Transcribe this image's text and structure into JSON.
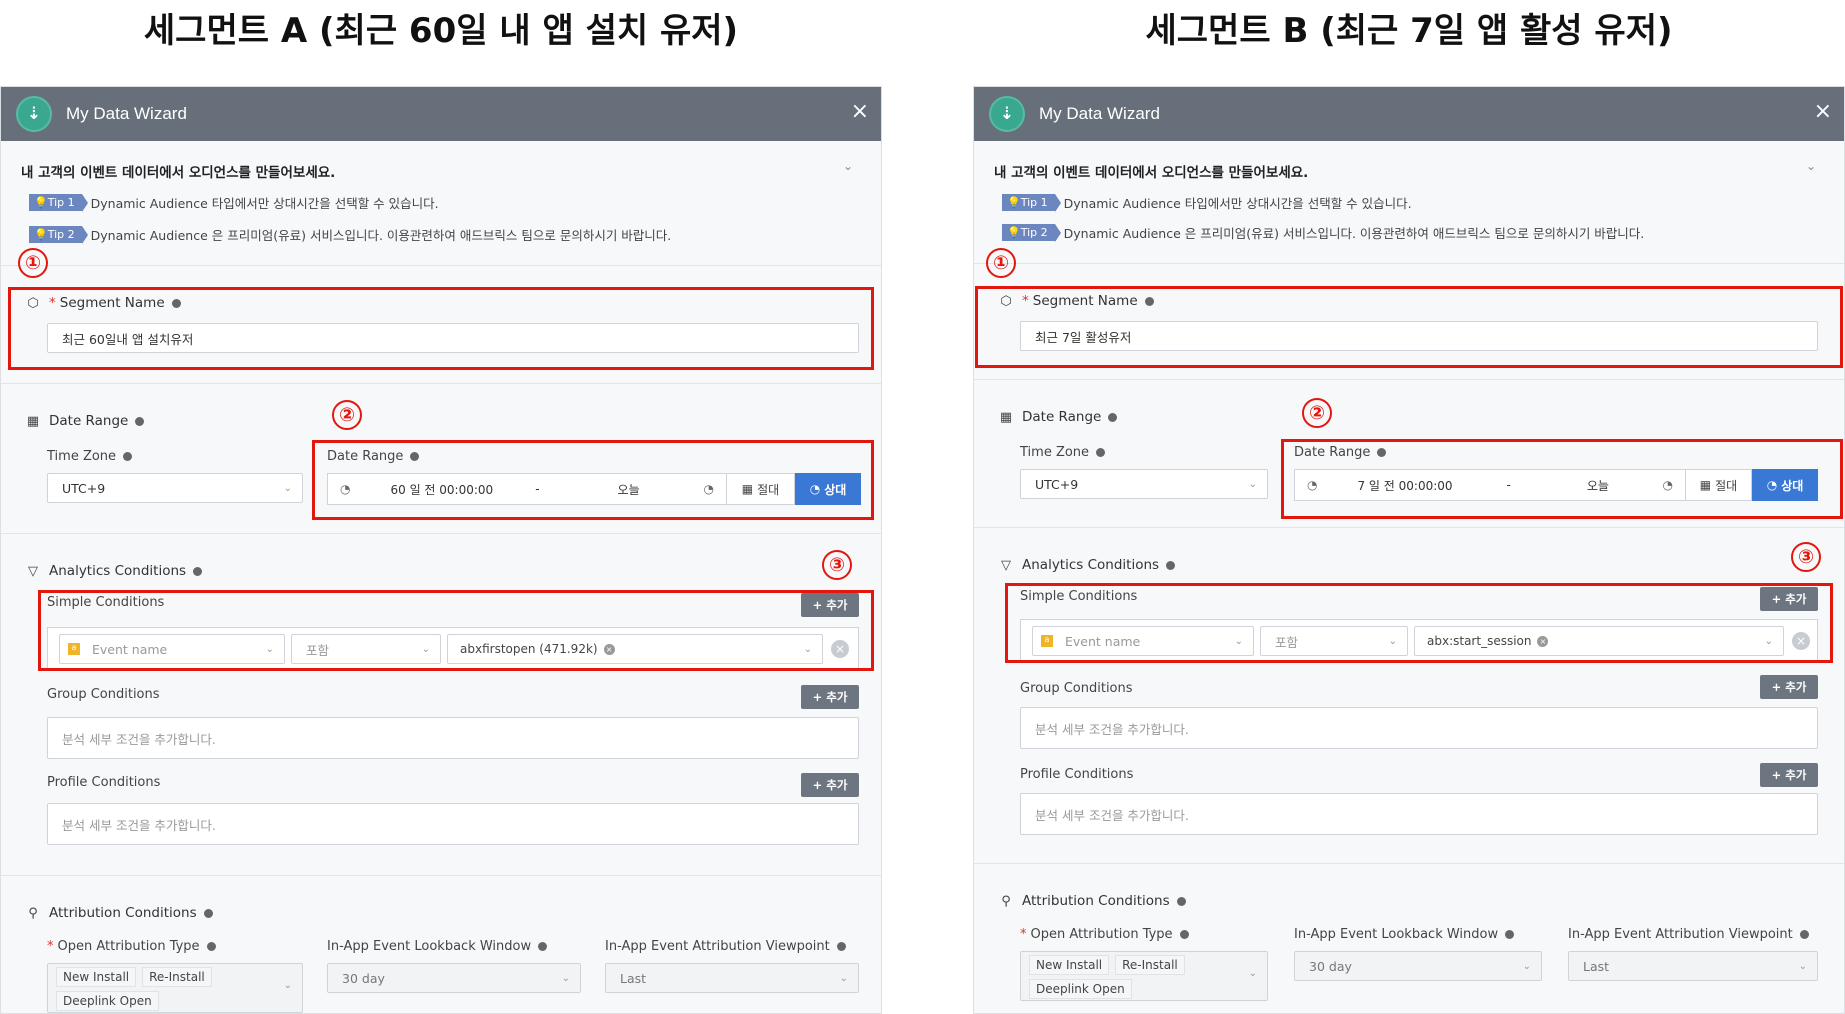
{
  "panels": [
    {
      "heading": "세그먼트 A (최근 60일 내 앱 설치 유저)",
      "app_title": "My Data Wizard",
      "close": "×",
      "description": "내 고객의 이벤트 데이터에서 오디언스를 만들어보세요.",
      "tips": [
        {
          "badge": "Tip 1",
          "text": "Dynamic Audience 타입에서만 상대시간을 선택할 수 있습니다."
        },
        {
          "badge": "Tip 2",
          "text": "Dynamic Audience 은 프리미엄(유료) 서비스입니다. 이용관련하여 애드브릭스 팀으로 문의하시기 바랍니다."
        }
      ],
      "segment_name_label": "Segment Name",
      "segment_name_value": "최근 60일내 앱 설치유저",
      "date_range_title": "Date Range",
      "time_zone_label": "Time Zone",
      "time_zone_value": "UTC+9",
      "date_range_label": "Date Range",
      "date_start": "60 일 전 00:00:00",
      "date_sep": "-",
      "date_end": "오늘",
      "btn_absolute": "절대",
      "btn_relative": "상대",
      "analytics_title": "Analytics Conditions",
      "simple_label": "Simple Conditions",
      "add_label": "+ 추가",
      "cond_field": "Event name",
      "cond_op": "포함",
      "cond_value": "abxfirstopen (471.92k)",
      "group_label": "Group Conditions",
      "group_placeholder": "분석 세부 조건을 추가합니다.",
      "profile_label": "Profile Conditions",
      "profile_placeholder": "분석 세부 조건을 추가합니다.",
      "attribution_title": "Attribution Conditions",
      "open_attr_label": "Open Attribution Type",
      "open_attr_tags": [
        "New Install",
        "Re-Install",
        "Deeplink Open"
      ],
      "lookback_label": "In-App Event Lookback Window",
      "lookback_value": "30 day",
      "viewpoint_label": "In-App Event Attribution Viewpoint",
      "viewpoint_value": "Last",
      "markers": [
        "①",
        "②",
        "③"
      ]
    },
    {
      "heading": "세그먼트 B (최근 7일 앱 활성 유저)",
      "app_title": "My Data Wizard",
      "close": "×",
      "description": "내 고객의 이벤트 데이터에서 오디언스를 만들어보세요.",
      "tips": [
        {
          "badge": "Tip 1",
          "text": "Dynamic Audience 타입에서만 상대시간을 선택할 수 있습니다."
        },
        {
          "badge": "Tip 2",
          "text": "Dynamic Audience 은 프리미엄(유료) 서비스입니다. 이용관련하여 애드브릭스 팀으로 문의하시기 바랍니다."
        }
      ],
      "segment_name_label": "Segment Name",
      "segment_name_value": "최근 7일 활성유저",
      "date_range_title": "Date Range",
      "time_zone_label": "Time Zone",
      "time_zone_value": "UTC+9",
      "date_range_label": "Date Range",
      "date_start": "7 일 전 00:00:00",
      "date_sep": "-",
      "date_end": "오늘",
      "btn_absolute": "절대",
      "btn_relative": "상대",
      "analytics_title": "Analytics Conditions",
      "simple_label": "Simple Conditions",
      "add_label": "+ 추가",
      "cond_field": "Event name",
      "cond_op": "포함",
      "cond_value": "abx:start_session",
      "group_label": "Group Conditions",
      "group_placeholder": "분석 세부 조건을 추가합니다.",
      "profile_label": "Profile Conditions",
      "profile_placeholder": "분석 세부 조건을 추가합니다.",
      "attribution_title": "Attribution Conditions",
      "open_attr_label": "Open Attribution Type",
      "open_attr_tags": [
        "New Install",
        "Re-Install",
        "Deeplink Open"
      ],
      "lookback_label": "In-App Event Lookback Window",
      "lookback_value": "30 day",
      "viewpoint_label": "In-App Event Attribution Viewpoint",
      "viewpoint_value": "Last",
      "markers": [
        "①",
        "②",
        "③"
      ]
    }
  ]
}
